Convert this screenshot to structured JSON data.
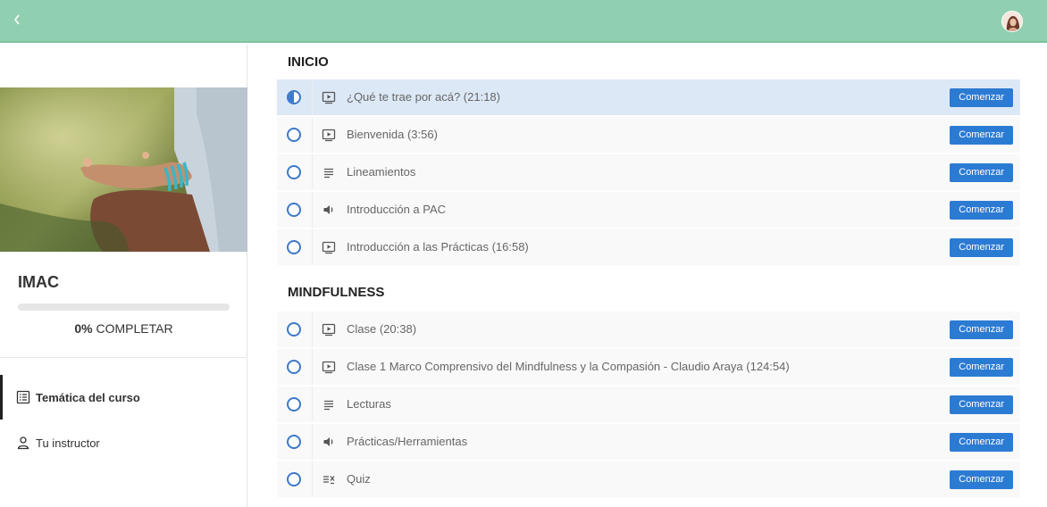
{
  "header": {
    "back_icon": "chevron-left-icon",
    "avatar": "user-avatar"
  },
  "sidebar": {
    "course_title": "IMAC",
    "progress": {
      "percent_text": "0%",
      "suffix": "COMPLETAR",
      "value": 0
    },
    "nav": [
      {
        "label": "Temática del curso",
        "icon": "curriculum-icon",
        "active": true
      },
      {
        "label": "Tu instructor",
        "icon": "user-icon",
        "active": false
      }
    ]
  },
  "sections": [
    {
      "title": "INICIO",
      "lessons": [
        {
          "title": "¿Qué te trae por acá? (21:18)",
          "type": "video",
          "status": "in-progress",
          "button": "Comenzar"
        },
        {
          "title": "Bienvenida (3:56)",
          "type": "video",
          "status": "not-started",
          "button": "Comenzar"
        },
        {
          "title": "Lineamientos",
          "type": "text",
          "status": "not-started",
          "button": "Comenzar"
        },
        {
          "title": "Introducción a PAC",
          "type": "audio",
          "status": "not-started",
          "button": "Comenzar"
        },
        {
          "title": "Introducción a las Prácticas (16:58)",
          "type": "video",
          "status": "not-started",
          "button": "Comenzar"
        }
      ]
    },
    {
      "title": "MINDFULNESS",
      "lessons": [
        {
          "title": "Clase (20:38)",
          "type": "video",
          "status": "not-started",
          "button": "Comenzar"
        },
        {
          "title": "Clase 1 Marco Comprensivo del Mindfulness y la Compasión - Claudio Araya (124:54)",
          "type": "video",
          "status": "not-started",
          "button": "Comenzar"
        },
        {
          "title": "Lecturas",
          "type": "text",
          "status": "not-started",
          "button": "Comenzar"
        },
        {
          "title": "Prácticas/Herramientas",
          "type": "audio",
          "status": "not-started",
          "button": "Comenzar"
        },
        {
          "title": "Quiz",
          "type": "quiz",
          "status": "not-started",
          "button": "Comenzar"
        }
      ]
    }
  ],
  "colors": {
    "header": "#91cfb1",
    "accent": "#2c7bd3",
    "status": "#3d79c7",
    "highlight": "#dce8f6"
  }
}
